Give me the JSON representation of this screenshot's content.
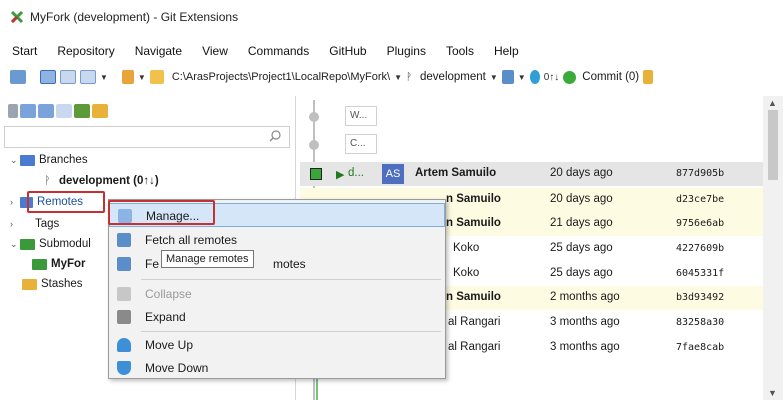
{
  "window": {
    "title": "MyFork (development) - Git Extensions"
  },
  "menu": [
    "Start",
    "Repository",
    "Navigate",
    "View",
    "Commands",
    "GitHub",
    "Plugins",
    "Tools",
    "Help"
  ],
  "toolbar": {
    "path": "C:\\ArasProjects\\Project1\\LocalRepo\\MyFork\\",
    "branch": "development",
    "counts": "0↑↓",
    "commit": "Commit (0)"
  },
  "tree": {
    "branches": "Branches",
    "current_branch": "development (0↑↓)",
    "remotes": "Remotes",
    "tags": "Tags",
    "submodules": "Submodul",
    "submodule_item": "MyFor",
    "stashes": "Stashes"
  },
  "filters": [
    "W...",
    "C..."
  ],
  "commits": [
    {
      "branch_label": "d...",
      "avatar": "AS",
      "author": "Artem Samuilo",
      "date": "20 days ago",
      "hash": "877d905b"
    },
    {
      "author": "n Samuilo",
      "date": "20 days ago",
      "hash": "d23ce7be"
    },
    {
      "author": "n Samuilo",
      "date": "21 days ago",
      "hash": "9756e6ab"
    },
    {
      "author": "Koko",
      "date": "25 days ago",
      "hash": "4227609b"
    },
    {
      "author": "Koko",
      "date": "25 days ago",
      "hash": "6045331f"
    },
    {
      "author": "n Samuilo",
      "date": "2 months ago",
      "hash": "b3d93492"
    },
    {
      "author": "al Rangari",
      "date": "3 months ago",
      "hash": "83258a30"
    },
    {
      "author": "al Rangari",
      "date": "3 months ago",
      "hash": "7fae8cab"
    }
  ],
  "context_menu": {
    "manage": "Manage...",
    "fetch_all": "Fetch all remotes",
    "fetch_prune_prefix": "Fe",
    "fetch_prune_suffix": "motes",
    "collapse": "Collapse",
    "expand": "Expand",
    "move_up": "Move Up",
    "move_down": "Move Down"
  },
  "tooltip": "Manage remotes",
  "colors": {
    "highlight_box": "#c53030",
    "hover": "#d5e6f8",
    "accent": "#4e6fbf"
  }
}
